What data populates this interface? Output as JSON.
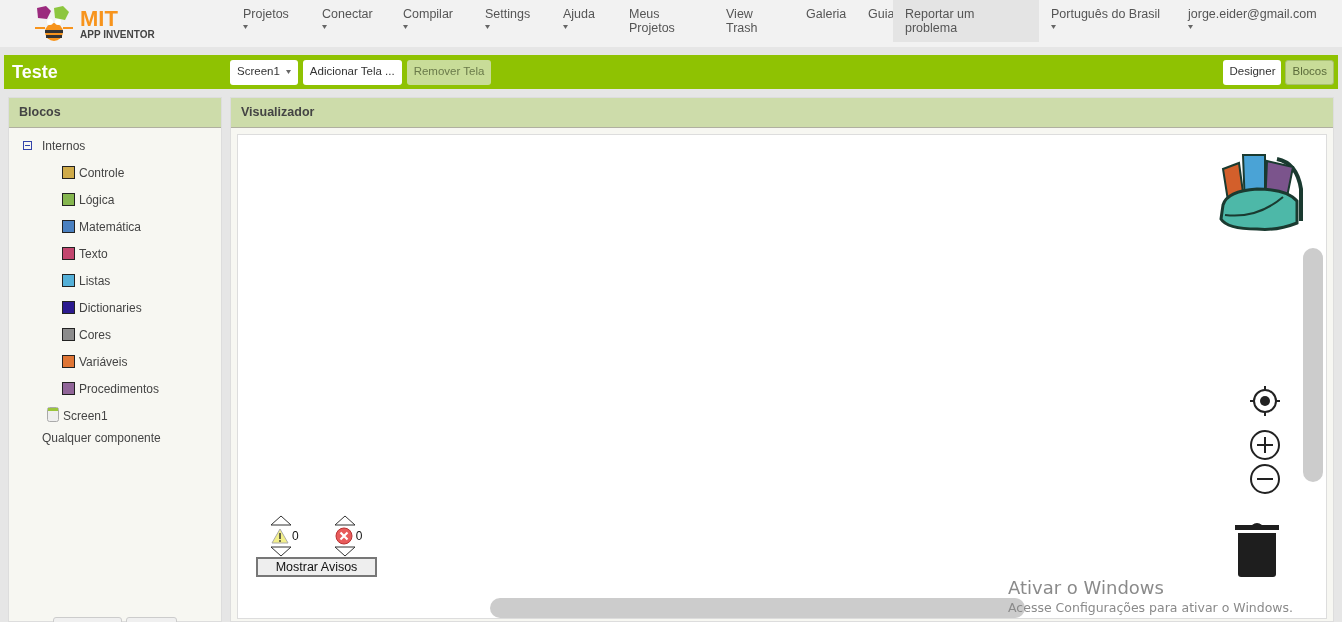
{
  "app": {
    "logo_title": "MIT",
    "logo_subtitle": "APP INVENTOR"
  },
  "nav": [
    {
      "label": "Projetos",
      "kind": "dropdown",
      "selected": false
    },
    {
      "label": "Conectar",
      "kind": "dropdown",
      "selected": false
    },
    {
      "label": "Compilar",
      "kind": "dropdown",
      "selected": false
    },
    {
      "label": "Settings",
      "kind": "dropdown",
      "selected": false
    },
    {
      "label": "Ajuda",
      "kind": "dropdown",
      "selected": false
    },
    {
      "label": "Meus\nProjetos",
      "kind": "link",
      "selected": false
    },
    {
      "label": "View\nTrash",
      "kind": "link",
      "selected": false
    },
    {
      "label": "Galeria",
      "kind": "link",
      "selected": false
    },
    {
      "label": "Guia",
      "kind": "link",
      "selected": false
    },
    {
      "label": "Reportar um\nproblema",
      "kind": "link",
      "selected": true
    },
    {
      "label": "Português do Brasil",
      "kind": "dropdown",
      "selected": false
    },
    {
      "label": "jorge.eider@gmail.com",
      "kind": "dropdown",
      "selected": false
    }
  ],
  "project_bar": {
    "title": "Teste",
    "screen_dropdown": "Screen1",
    "add_screen": "Adicionar Tela ...",
    "remove_screen": {
      "label": "Remover Tela",
      "disabled": true
    },
    "views": [
      {
        "label": "Designer",
        "selected": false
      },
      {
        "label": "Blocos",
        "selected": true
      }
    ]
  },
  "blocks_panel": {
    "title": "Blocos",
    "tree": [
      {
        "label": "Internos",
        "kind": "group",
        "expanded": true,
        "children": [
          {
            "label": "Controle",
            "color": "#cfab4a"
          },
          {
            "label": "Lógica",
            "color": "#85b64f"
          },
          {
            "label": "Matemática",
            "color": "#4a80c0"
          },
          {
            "label": "Texto",
            "color": "#c2466e"
          },
          {
            "label": "Listas",
            "color": "#54b0d8"
          },
          {
            "label": "Dictionaries",
            "color": "#2b1a8f"
          },
          {
            "label": "Cores",
            "color": "#8c8c8c"
          },
          {
            "label": "Variáveis",
            "color": "#df7535"
          },
          {
            "label": "Procedimentos",
            "color": "#906598"
          }
        ]
      },
      {
        "label": "Screen1",
        "kind": "component"
      },
      {
        "label": "Qualquer componente",
        "kind": "plain"
      }
    ]
  },
  "viewer": {
    "title": "Visualizador",
    "warnings": "0",
    "errors": "0",
    "show_warnings_button": "Mostrar Avisos"
  },
  "windows_activation_notice": {
    "title": "Ativar o Windows",
    "message": "Acesse Configurações para ativar o Windows."
  }
}
